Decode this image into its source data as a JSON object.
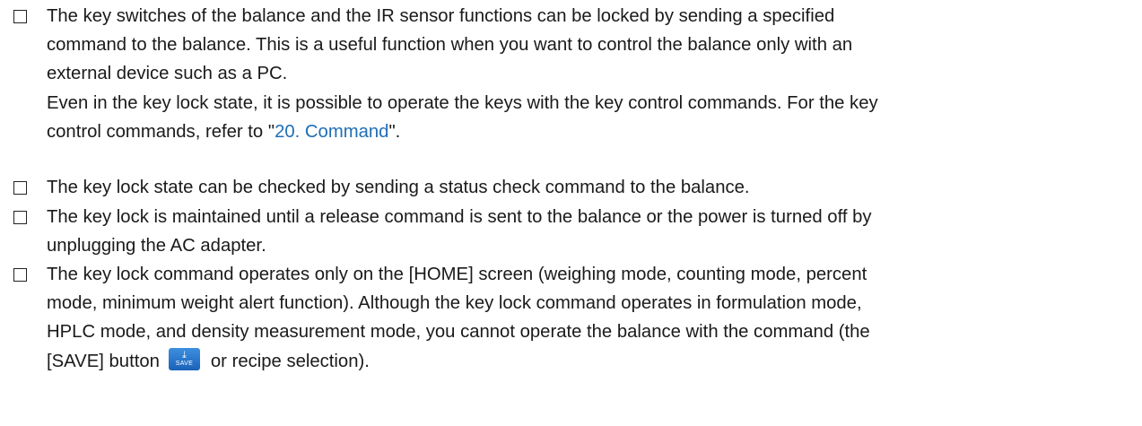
{
  "bullets": [
    {
      "lines": [
        "The key switches of the balance and the IR sensor functions can be locked by sending a specified",
        "command to the balance. This is a useful function when you want to control the balance only with an",
        "external device such as a PC.",
        "Even in the key lock state, it is possible to operate the keys with the key control commands. For the key"
      ],
      "last_line_before_link": "control commands, refer to \"",
      "link_text": "20. Command",
      "last_line_after_link": "\"."
    },
    {
      "lines": [
        "The key lock state can be checked by sending a status check command to the balance."
      ]
    },
    {
      "lines": [
        "The key lock is maintained until a release command is sent to the balance or the power is turned off by",
        "unplugging the AC adapter."
      ]
    },
    {
      "lines": [
        "The key lock command operates only on the [HOME] screen (weighing mode, counting mode, percent",
        "mode, minimum weight alert function). Although the key lock command operates in formulation mode,",
        "HPLC mode, and density measurement mode, you cannot operate the balance with the command (the"
      ],
      "last_line_before_button": "[SAVE] button",
      "save_button_label": "SAVE",
      "last_line_after_button": "or recipe selection)."
    }
  ],
  "icons": {
    "checkbox": "checkbox-outline-icon",
    "save": "save-download-icon"
  },
  "colors": {
    "link": "#1f6fb6",
    "save_button": "#2a76cc"
  }
}
